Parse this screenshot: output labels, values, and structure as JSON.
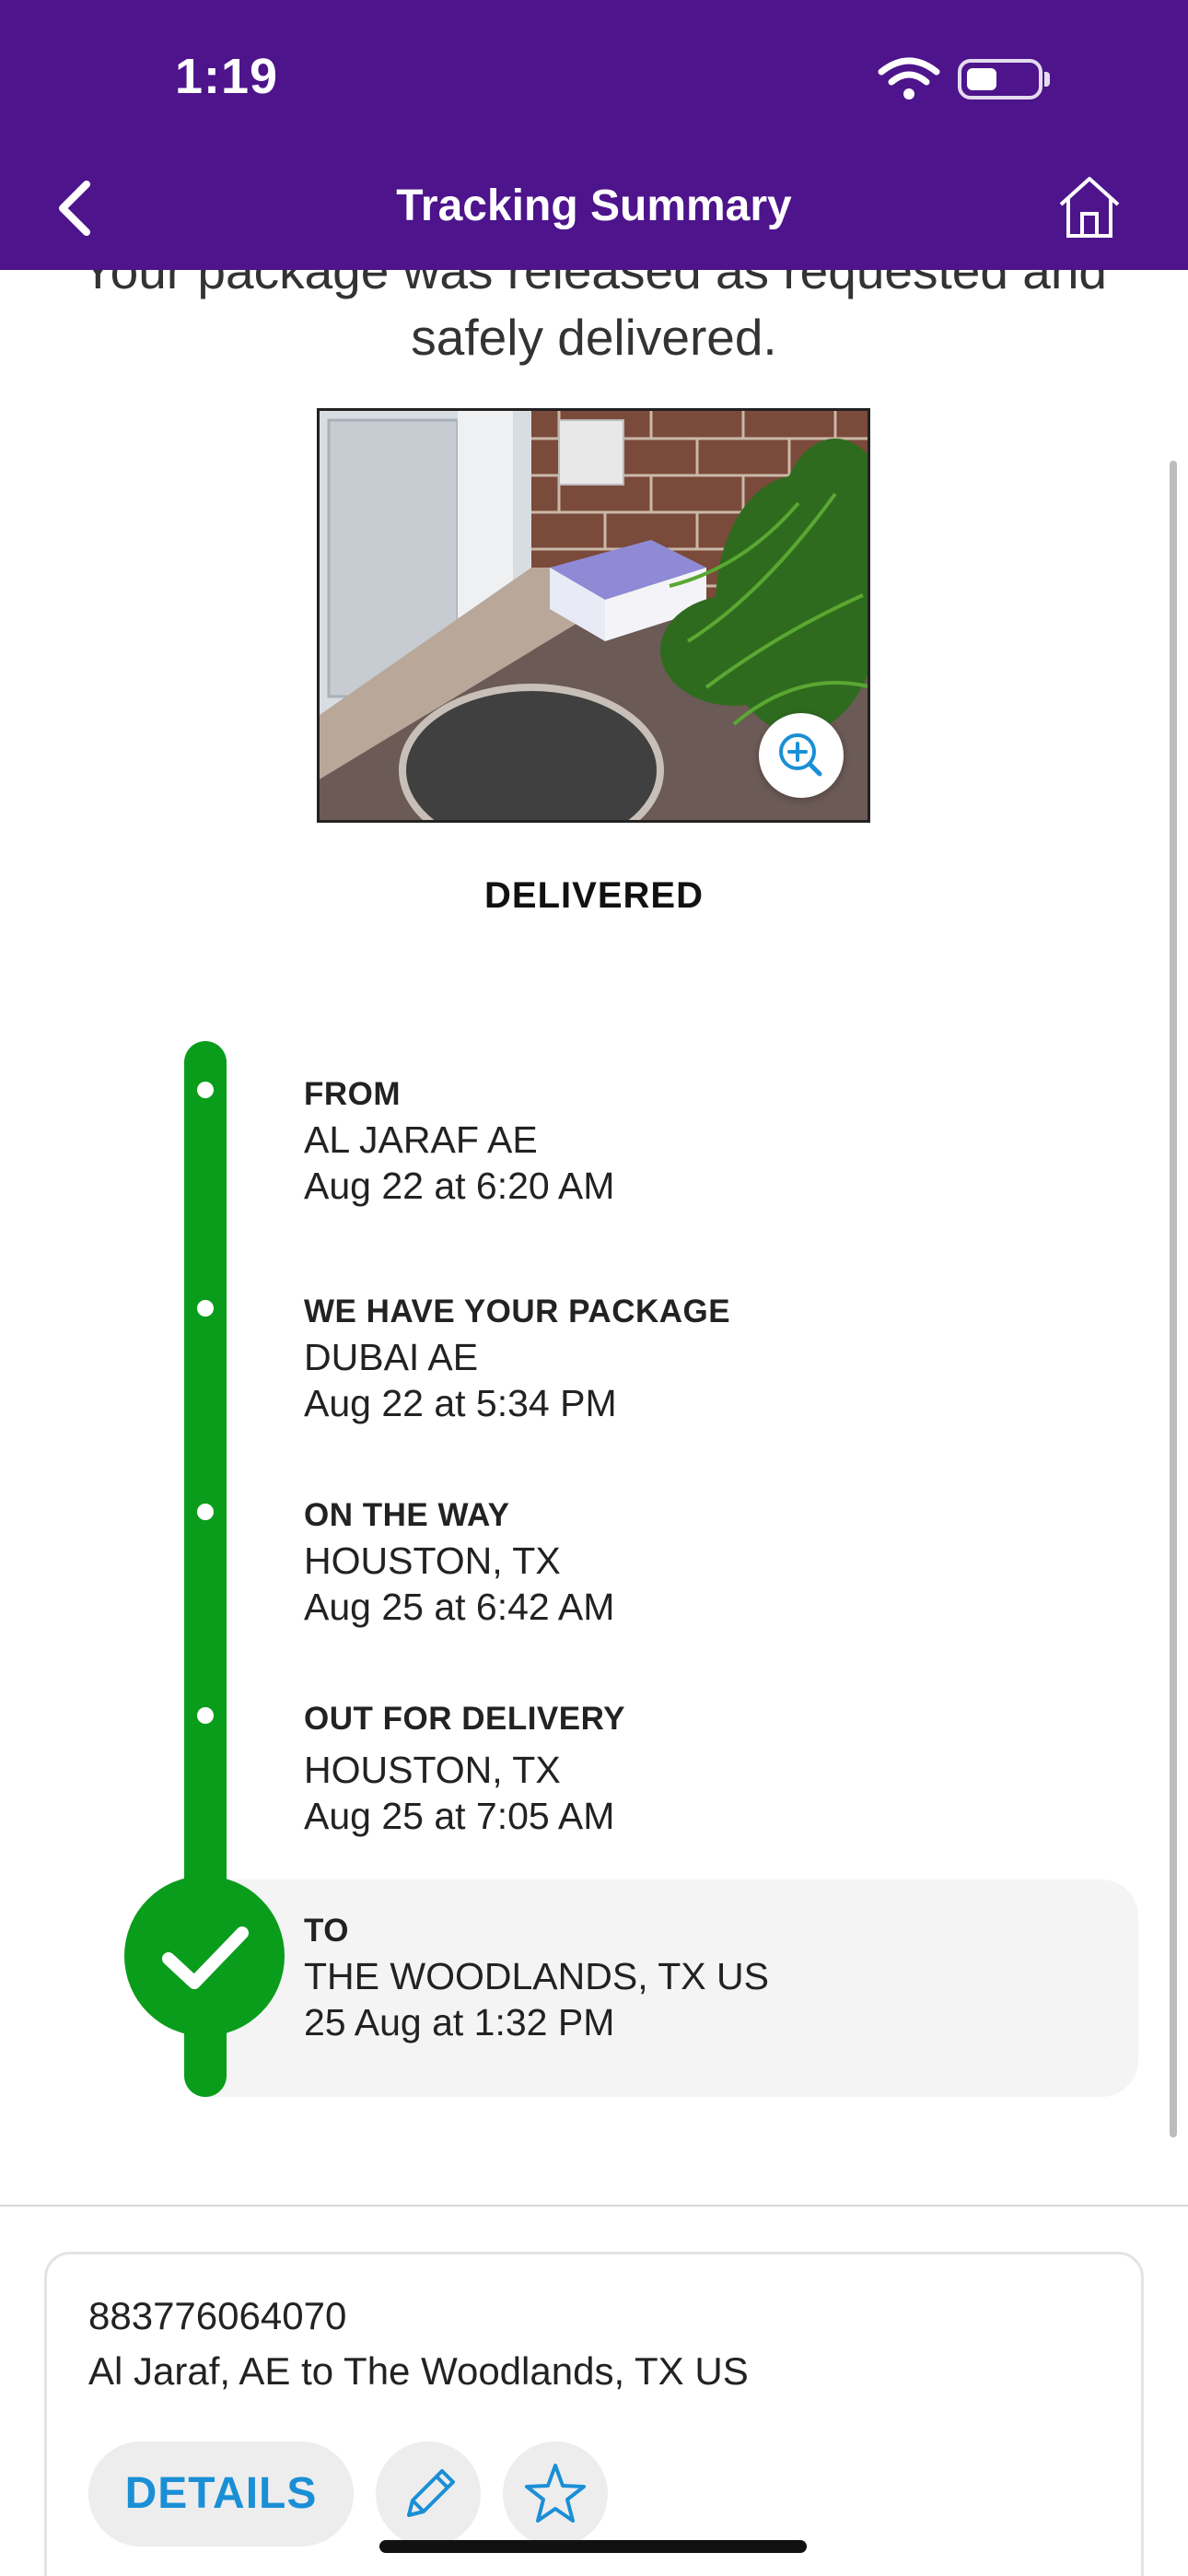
{
  "status_bar": {
    "time": "1:19"
  },
  "nav": {
    "title": "Tracking Summary"
  },
  "message": {
    "line1": "Your package was released as requested and",
    "line2": "safely delivered."
  },
  "delivery_status": "DELIVERED",
  "timeline": {
    "events": [
      {
        "label": "FROM",
        "location": "AL JARAF AE",
        "time": "Aug 22 at 6:20 AM"
      },
      {
        "label": "WE HAVE YOUR PACKAGE",
        "location": "DUBAI AE",
        "time": "Aug 22 at 5:34 PM"
      },
      {
        "label": "ON THE WAY",
        "location": "HOUSTON, TX",
        "time": "Aug 25 at 6:42 AM"
      },
      {
        "label": "OUT FOR DELIVERY",
        "location": "HOUSTON, TX",
        "time": "Aug 25 at 7:05 AM"
      },
      {
        "label": "TO",
        "location": "THE WOODLANDS, TX US",
        "time": "25 Aug at 1:32 PM"
      }
    ]
  },
  "shipment_card": {
    "tracking_number": "883776064070",
    "route": "Al Jaraf, AE to The Woodlands, TX US",
    "details_label": "DETAILS"
  },
  "colors": {
    "brand_purple": "#4d148c",
    "progress_green": "#0a9d1c",
    "link_blue": "#1a8fd6"
  },
  "icons": [
    "back-chevron-icon",
    "home-icon",
    "wifi-icon",
    "battery-icon",
    "zoom-in-icon",
    "checkmark-icon",
    "pencil-icon",
    "star-icon"
  ]
}
